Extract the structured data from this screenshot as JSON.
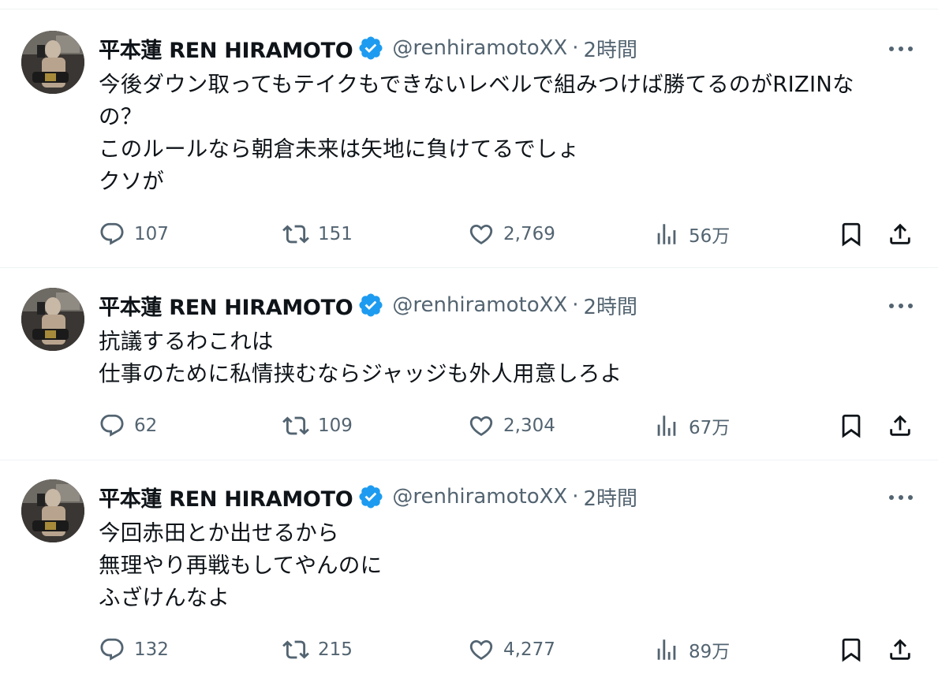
{
  "tweets": [
    {
      "display_name": "平本蓮 REN HIRAMOTO",
      "handle": "@renhiramotoXX",
      "separator": "·",
      "time": "2時間",
      "lines": [
        "今後ダウン取ってもテイクもできないレベルで組みつけば勝てるのがRIZINな",
        "の？",
        "このルールなら朝倉未来は矢地に負けてるでしょ",
        "クソが"
      ],
      "replies": "107",
      "reposts": "151",
      "likes": "2,769",
      "views": "56万"
    },
    {
      "display_name": "平本蓮 REN HIRAMOTO",
      "handle": "@renhiramotoXX",
      "separator": "·",
      "time": "2時間",
      "lines": [
        "抗議するわこれは",
        "仕事のために私情挟むならジャッジも外人用意しろよ"
      ],
      "replies": "62",
      "reposts": "109",
      "likes": "2,304",
      "views": "67万"
    },
    {
      "display_name": "平本蓮 REN HIRAMOTO",
      "handle": "@renhiramotoXX",
      "separator": "·",
      "time": "2時間",
      "lines": [
        "今回赤田とか出せるから",
        "無理やり再戦もしてやんのに",
        "ふざけんなよ"
      ],
      "replies": "132",
      "reposts": "215",
      "likes": "4,277",
      "views": "89万"
    }
  ],
  "icons": {
    "verified": "verified-badge-icon",
    "more": "more-options-icon",
    "reply": "reply-icon",
    "repost": "repost-icon",
    "like": "heart-icon",
    "views": "views-chart-icon",
    "bookmark": "bookmark-icon",
    "share": "share-icon"
  },
  "colors": {
    "text": "#0f1419",
    "secondary": "#536471",
    "verified": "#1d9bf0",
    "border": "#eff3f4"
  }
}
